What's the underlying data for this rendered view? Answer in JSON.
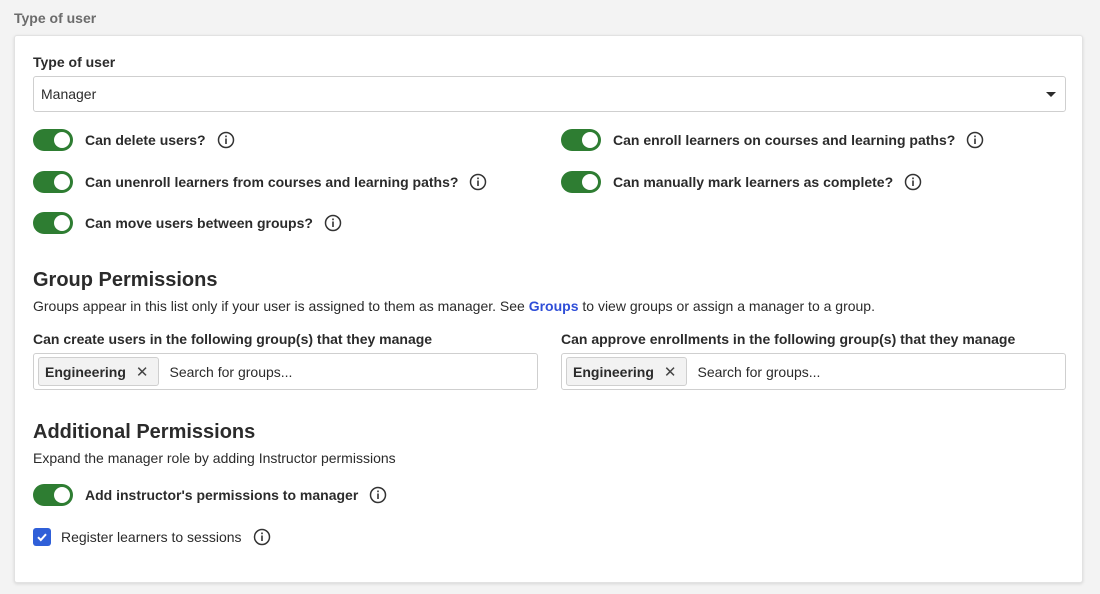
{
  "section_label": "Type of user",
  "user_type": {
    "label": "Type of user",
    "value": "Manager"
  },
  "permissions": {
    "delete_users": "Can delete users?",
    "enroll_learners": "Can enroll learners on courses and learning paths?",
    "unenroll_learners": "Can unenroll learners from courses and learning paths?",
    "mark_complete": "Can manually mark learners as complete?",
    "move_users": "Can move users between groups?"
  },
  "group_permissions": {
    "title": "Group Permissions",
    "description_before": "Groups appear in this list only if your user is assigned to them as manager. See ",
    "description_link": "Groups",
    "description_after": " to view groups or assign a manager to a group.",
    "create_users": {
      "label": "Can create users in the following group(s) that they manage",
      "tag": "Engineering",
      "placeholder": "Search for groups..."
    },
    "approve_enrollments": {
      "label": "Can approve enrollments in the following group(s) that they manage",
      "tag": "Engineering",
      "placeholder": "Search for groups..."
    }
  },
  "additional_permissions": {
    "title": "Additional Permissions",
    "description": "Expand the manager role by adding Instructor permissions",
    "instructor_toggle": "Add instructor's permissions to manager",
    "register_sessions": "Register learners to sessions"
  },
  "icons": {
    "info": "info-circle-icon",
    "tag_remove": "close-icon",
    "dropdown": "caret-down-icon",
    "check": "checkmark-icon"
  },
  "colors": {
    "toggle_on": "#2e7d32",
    "link": "#2f4ed8",
    "checkbox": "#2f5fd8"
  },
  "tag_remove_glyph": "✕"
}
